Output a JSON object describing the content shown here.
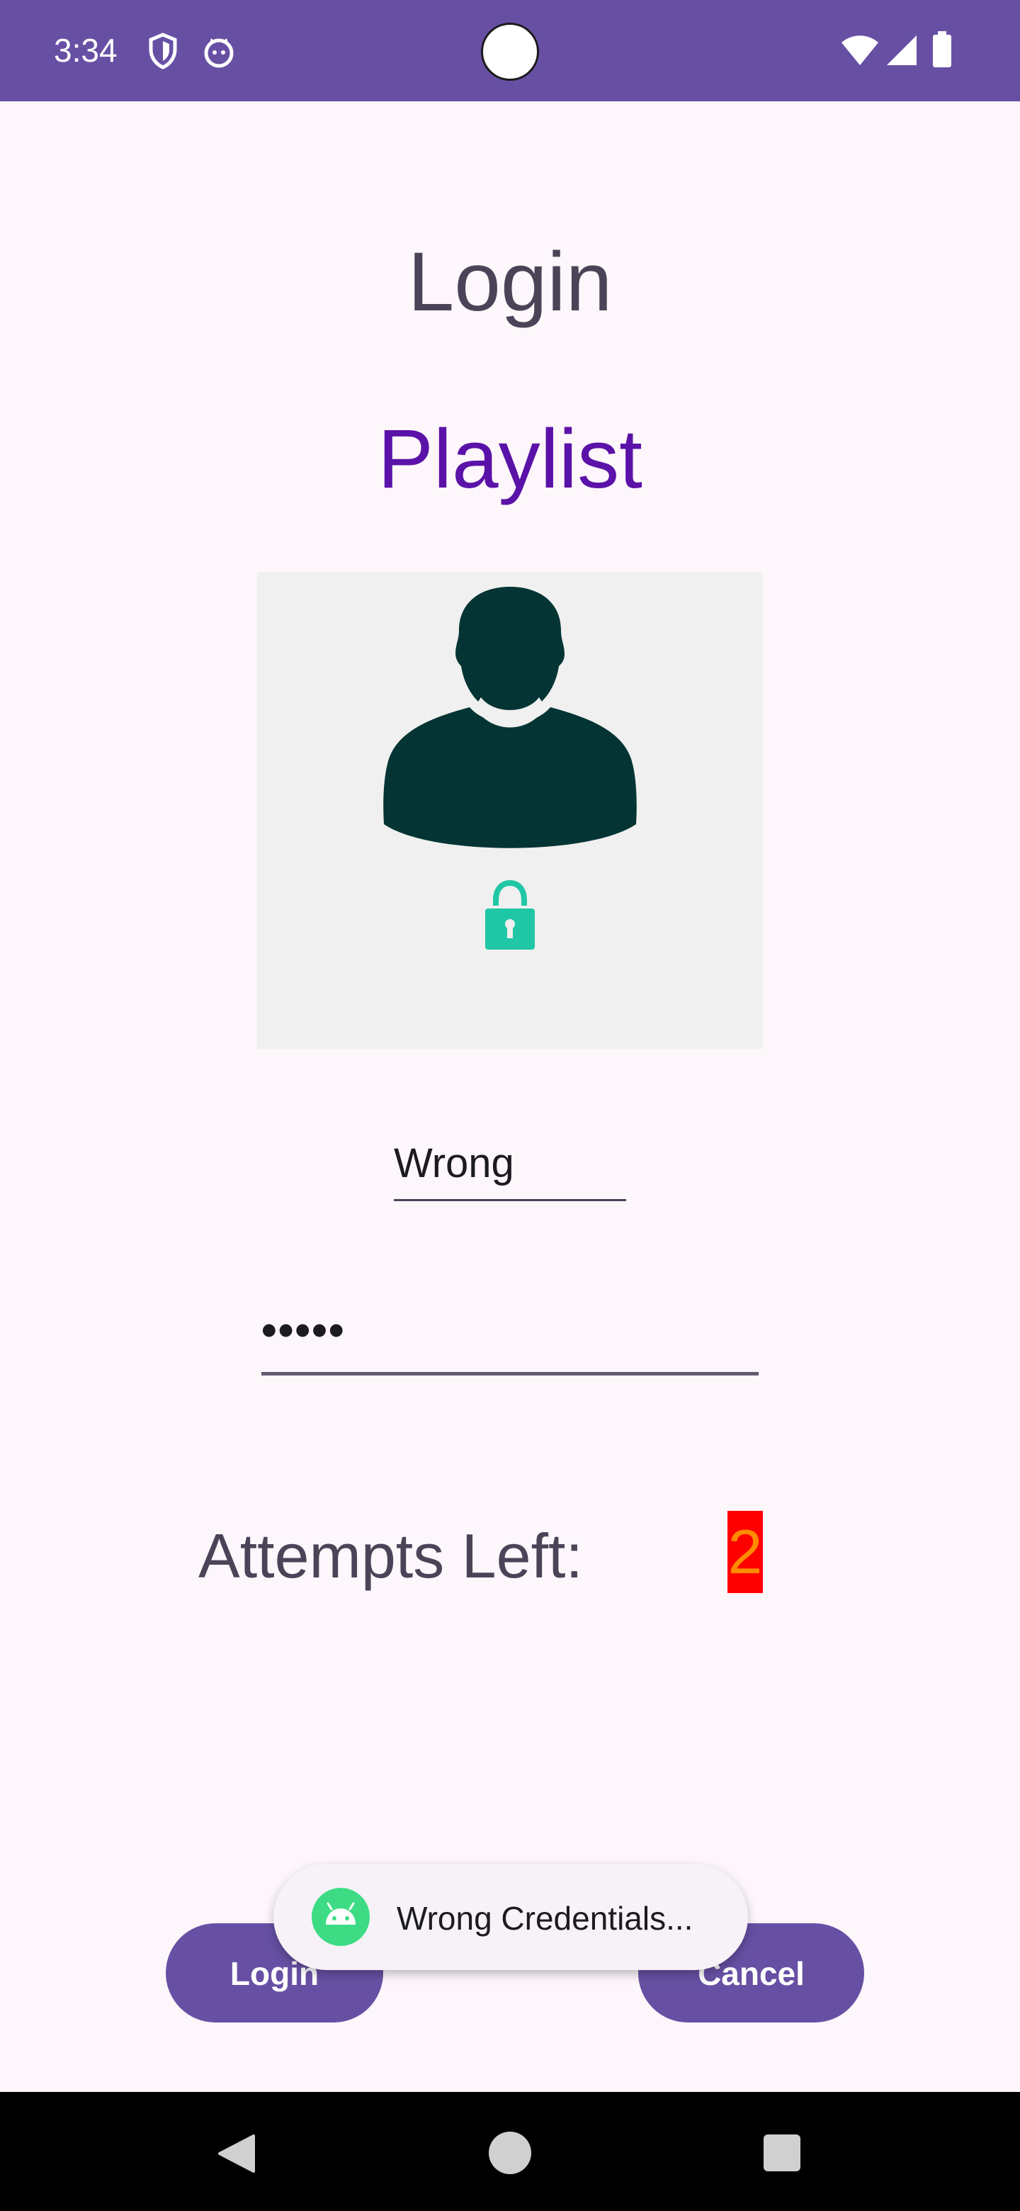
{
  "status_bar": {
    "time": "3:34",
    "left_icons": [
      "shield-icon",
      "cat-face-icon"
    ],
    "right_icons": [
      "wifi-icon",
      "signal-icon",
      "battery-icon"
    ]
  },
  "screen": {
    "title": "Login",
    "app_name": "Playlist",
    "avatar_icon": "user-lock-icon"
  },
  "form": {
    "username_value": "Wrong",
    "password_value": "•••••",
    "attempts_label": "Attempts Left:",
    "attempts_count": "2"
  },
  "buttons": {
    "login_label": "Login",
    "cancel_label": "Cancel"
  },
  "toast": {
    "icon": "android-icon",
    "message": "Wrong Credentials..."
  },
  "nav_bar": {
    "buttons": [
      "back-icon",
      "home-icon",
      "recents-icon"
    ]
  },
  "colors": {
    "primary": "#6750a4",
    "app_name": "#5b12a8",
    "attempts_bg": "#ff0000",
    "attempts_text": "#ff8c00"
  }
}
